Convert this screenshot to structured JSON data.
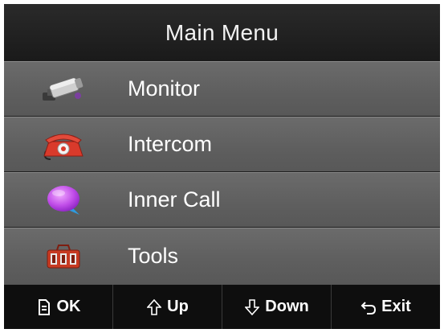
{
  "header": {
    "title": "Main Menu"
  },
  "menu": {
    "items": [
      {
        "label": "Monitor",
        "icon": "camera-icon"
      },
      {
        "label": "Intercom",
        "icon": "telephone-icon"
      },
      {
        "label": "Inner Call",
        "icon": "chat-bubble-icon"
      },
      {
        "label": "Tools",
        "icon": "toolbox-icon"
      }
    ]
  },
  "footer": {
    "buttons": [
      {
        "label": "OK",
        "icon": "document-icon"
      },
      {
        "label": "Up",
        "icon": "arrow-up-icon"
      },
      {
        "label": "Down",
        "icon": "arrow-down-icon"
      },
      {
        "label": "Exit",
        "icon": "return-icon"
      }
    ]
  },
  "colors": {
    "header_bg": "#1e1e1e",
    "item_bg": "#5e5e5e",
    "footer_bg": "#0e0e0e",
    "text": "#ffffff"
  }
}
